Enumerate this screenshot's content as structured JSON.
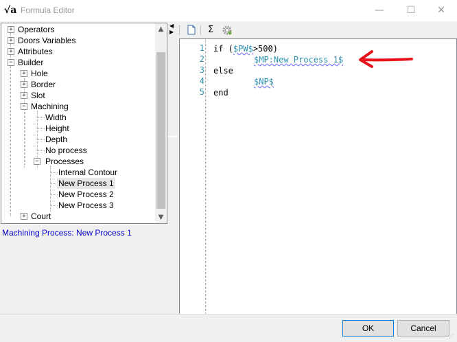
{
  "window": {
    "title": "Formula Editor",
    "icon_glyph": "√a",
    "minimize": "—",
    "maximize": "☐",
    "close": "✕"
  },
  "tree": {
    "items": [
      {
        "label": "Operators",
        "exp": "+"
      },
      {
        "label": "Doors Variables",
        "exp": "+"
      },
      {
        "label": "Attributes",
        "exp": "+"
      },
      {
        "label": "Builder",
        "exp": "−"
      },
      {
        "label": "Hole",
        "exp": "+"
      },
      {
        "label": "Border",
        "exp": "+"
      },
      {
        "label": "Slot",
        "exp": "+"
      },
      {
        "label": "Machining",
        "exp": "−"
      },
      {
        "label": "Width"
      },
      {
        "label": "Height"
      },
      {
        "label": "Depth"
      },
      {
        "label": "No process"
      },
      {
        "label": "Processes",
        "exp": "−"
      },
      {
        "label": "Internal Contour"
      },
      {
        "label": "New Process 1"
      },
      {
        "label": "New Process 2"
      },
      {
        "label": "New Process 3"
      },
      {
        "label": "Court",
        "exp": "+"
      }
    ]
  },
  "status": {
    "text": "Machining Process: New Process 1"
  },
  "toolbar": {
    "sigma": "Σ"
  },
  "editor": {
    "line_numbers": [
      "1",
      "2",
      "3",
      "4",
      "5"
    ],
    "lines": {
      "l1_pre": "if (",
      "l1_var": "$PW$",
      "l1_post": ">500)",
      "l2_var": "$MP:New Process 1$",
      "l3": "else",
      "l4_var": "$NP$",
      "l5": "end"
    }
  },
  "buttons": {
    "ok": "OK",
    "cancel": "Cancel"
  },
  "colors": {
    "annotation_arrow": "#e8141c",
    "variable": "#2b91af",
    "status_text": "#0000cc"
  }
}
